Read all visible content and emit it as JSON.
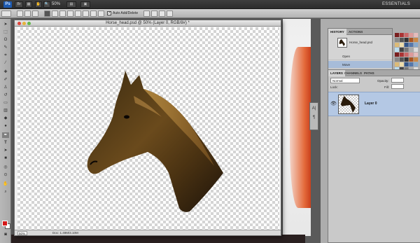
{
  "app": {
    "logo": "Ps",
    "zoom": "50%",
    "workspace": "ESSENTIALS"
  },
  "options_bar": {
    "auto_add_delete": "Auto Add/Delete",
    "auto_add_checked": true
  },
  "document": {
    "title": "Horse_head.psd @ 50% (Layer 0, RGB/8#) *",
    "zoom": "50%",
    "doc_size": "Doc: 1.49M/4.10M"
  },
  "history_panel": {
    "tabs": [
      "HISTORY",
      "ACTIONS"
    ],
    "snapshot_name": "Horse_head.psd",
    "states": [
      "Open",
      "Move"
    ]
  },
  "layers_panel": {
    "tabs": [
      "LAYERS",
      "CHANNELS",
      "PATHS"
    ],
    "blend_mode": "Normal",
    "opacity_label": "Opacity:",
    "lock_label": "Lock:",
    "fill_label": "Fill:",
    "layer_name": "Layer 0"
  },
  "mini_panel": {
    "icons": [
      "character-icon",
      "paragraph-icon"
    ]
  },
  "colors": {
    "foreground": "#d41a1a",
    "background": "#ffffff",
    "selection": "#b4c8e4"
  }
}
